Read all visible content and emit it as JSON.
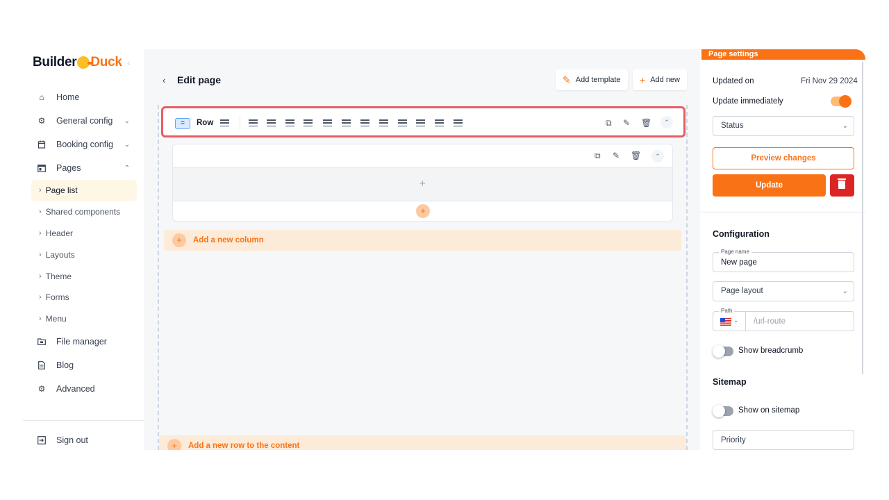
{
  "app": {
    "logo_left": "Builder",
    "logo_right": "Duck"
  },
  "sidebar": {
    "items": [
      {
        "label": "Home"
      },
      {
        "label": "General config"
      },
      {
        "label": "Booking config"
      },
      {
        "label": "Pages"
      }
    ],
    "sub_items": [
      {
        "label": "Page list"
      },
      {
        "label": "Shared components"
      },
      {
        "label": "Header"
      },
      {
        "label": "Layouts"
      },
      {
        "label": "Theme"
      },
      {
        "label": "Forms"
      },
      {
        "label": "Menu"
      }
    ],
    "bottom_items": [
      {
        "label": "File manager"
      },
      {
        "label": "Blog"
      },
      {
        "label": "Advanced"
      }
    ],
    "sign_out": "Sign out"
  },
  "header": {
    "title": "Edit page",
    "add_template": "Add template",
    "add_new": "Add new"
  },
  "builder": {
    "row_label": "Row",
    "add_column": "Add a new column",
    "add_row": "Add a new row to the content"
  },
  "panel": {
    "tab": "Page settings",
    "updated_on_label": "Updated on",
    "updated_on_value": "Fri Nov 29 2024",
    "update_immediately": "Update immediately",
    "status_placeholder": "Status",
    "preview_changes": "Preview changes",
    "update": "Update",
    "configuration": "Configuration",
    "page_name_label": "Page name",
    "page_name_value": "New page",
    "page_layout": "Page layout",
    "path_label": "Path",
    "path_placeholder": "/url-route",
    "show_breadcrumb": "Show breadcrumb",
    "sitemap": "Sitemap",
    "show_on_sitemap": "Show on sitemap",
    "priority": "Priority"
  },
  "colors": {
    "accent": "#f97316",
    "danger": "#dc2626",
    "highlight": "#e75c63"
  }
}
